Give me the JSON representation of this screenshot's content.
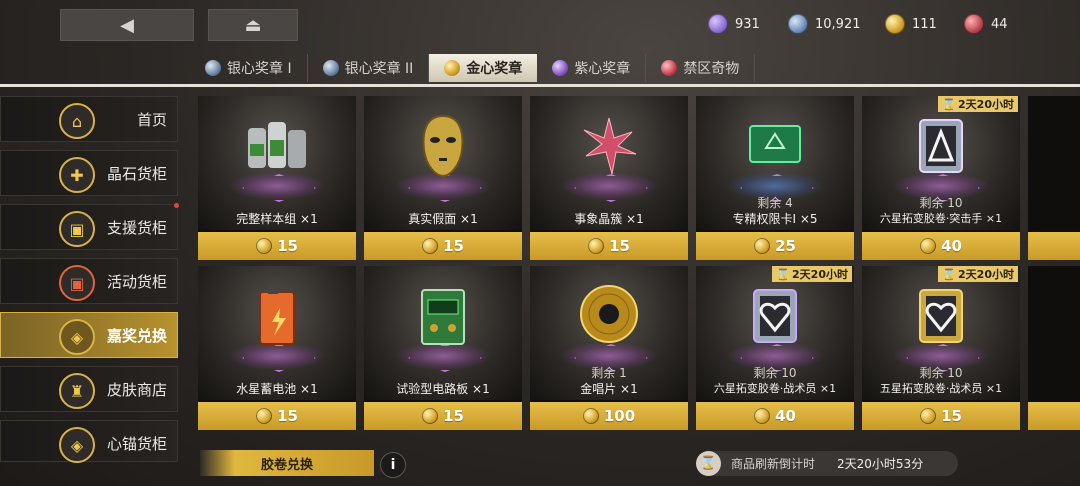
{
  "currencies": [
    {
      "value": "931",
      "icon": "purple-gem-icon",
      "color": "#8f6ad0"
    },
    {
      "value": "10,921",
      "icon": "blue-gem-icon",
      "color": "#6a8ab8"
    },
    {
      "value": "111",
      "icon": "gold-coin-icon",
      "color": "#d6a52c"
    },
    {
      "value": "44",
      "icon": "red-coin-icon",
      "color": "#b8434b"
    }
  ],
  "tabs": [
    {
      "label": "银心奖章 I",
      "color": "#6b86a6"
    },
    {
      "label": "银心奖章 II",
      "color": "#6b86a6"
    },
    {
      "label": "金心奖章",
      "color": "#d6a52c"
    },
    {
      "label": "紫心奖章",
      "color": "#8a58c8"
    },
    {
      "label": "禁区奇物",
      "color": "#c8404a"
    }
  ],
  "sidebar": [
    {
      "label": "首页",
      "icon": "home-icon"
    },
    {
      "label": "晶石货柜",
      "icon": "crystal-icon"
    },
    {
      "label": "支援货柜",
      "icon": "supply-crate-icon"
    },
    {
      "label": "活动货柜",
      "icon": "event-crate-icon"
    },
    {
      "label": "嘉奖兑换",
      "icon": "medal-icon"
    },
    {
      "label": "皮肤商店",
      "icon": "outfit-icon"
    },
    {
      "label": "心锚货柜",
      "icon": "anchor-icon"
    }
  ],
  "items": [
    {
      "name": "完整样本组 ×1",
      "price": "15",
      "stock": "",
      "timer": ""
    },
    {
      "name": "真实假面 ×1",
      "price": "15",
      "stock": "",
      "timer": ""
    },
    {
      "name": "事象晶簇 ×1",
      "price": "15",
      "stock": "",
      "timer": ""
    },
    {
      "name": "专精权限卡Ⅰ ×5",
      "price": "25",
      "stock": "剩余 4",
      "timer": ""
    },
    {
      "name": "六星拓变胶卷·突击手 ×1",
      "price": "40",
      "stock": "剩余 10",
      "timer": "2天20小时"
    },
    {
      "name": "水星蓄电池 ×1",
      "price": "15",
      "stock": "",
      "timer": ""
    },
    {
      "name": "试验型电路板 ×1",
      "price": "15",
      "stock": "",
      "timer": ""
    },
    {
      "name": "金唱片 ×1",
      "price": "100",
      "stock": "剩余 1",
      "timer": ""
    },
    {
      "name": "六星拓变胶卷·战术员 ×1",
      "price": "40",
      "stock": "剩余 10",
      "timer": "2天20小时"
    },
    {
      "name": "五星拓变胶卷·战术员 ×1",
      "price": "15",
      "stock": "剩余 10",
      "timer": "2天20小时"
    }
  ],
  "bottom": {
    "exchange_label": "胶卷兑换",
    "info_label": "i",
    "refresh_label": "商品刷新倒计时",
    "refresh_value": "2天20小时53分"
  }
}
